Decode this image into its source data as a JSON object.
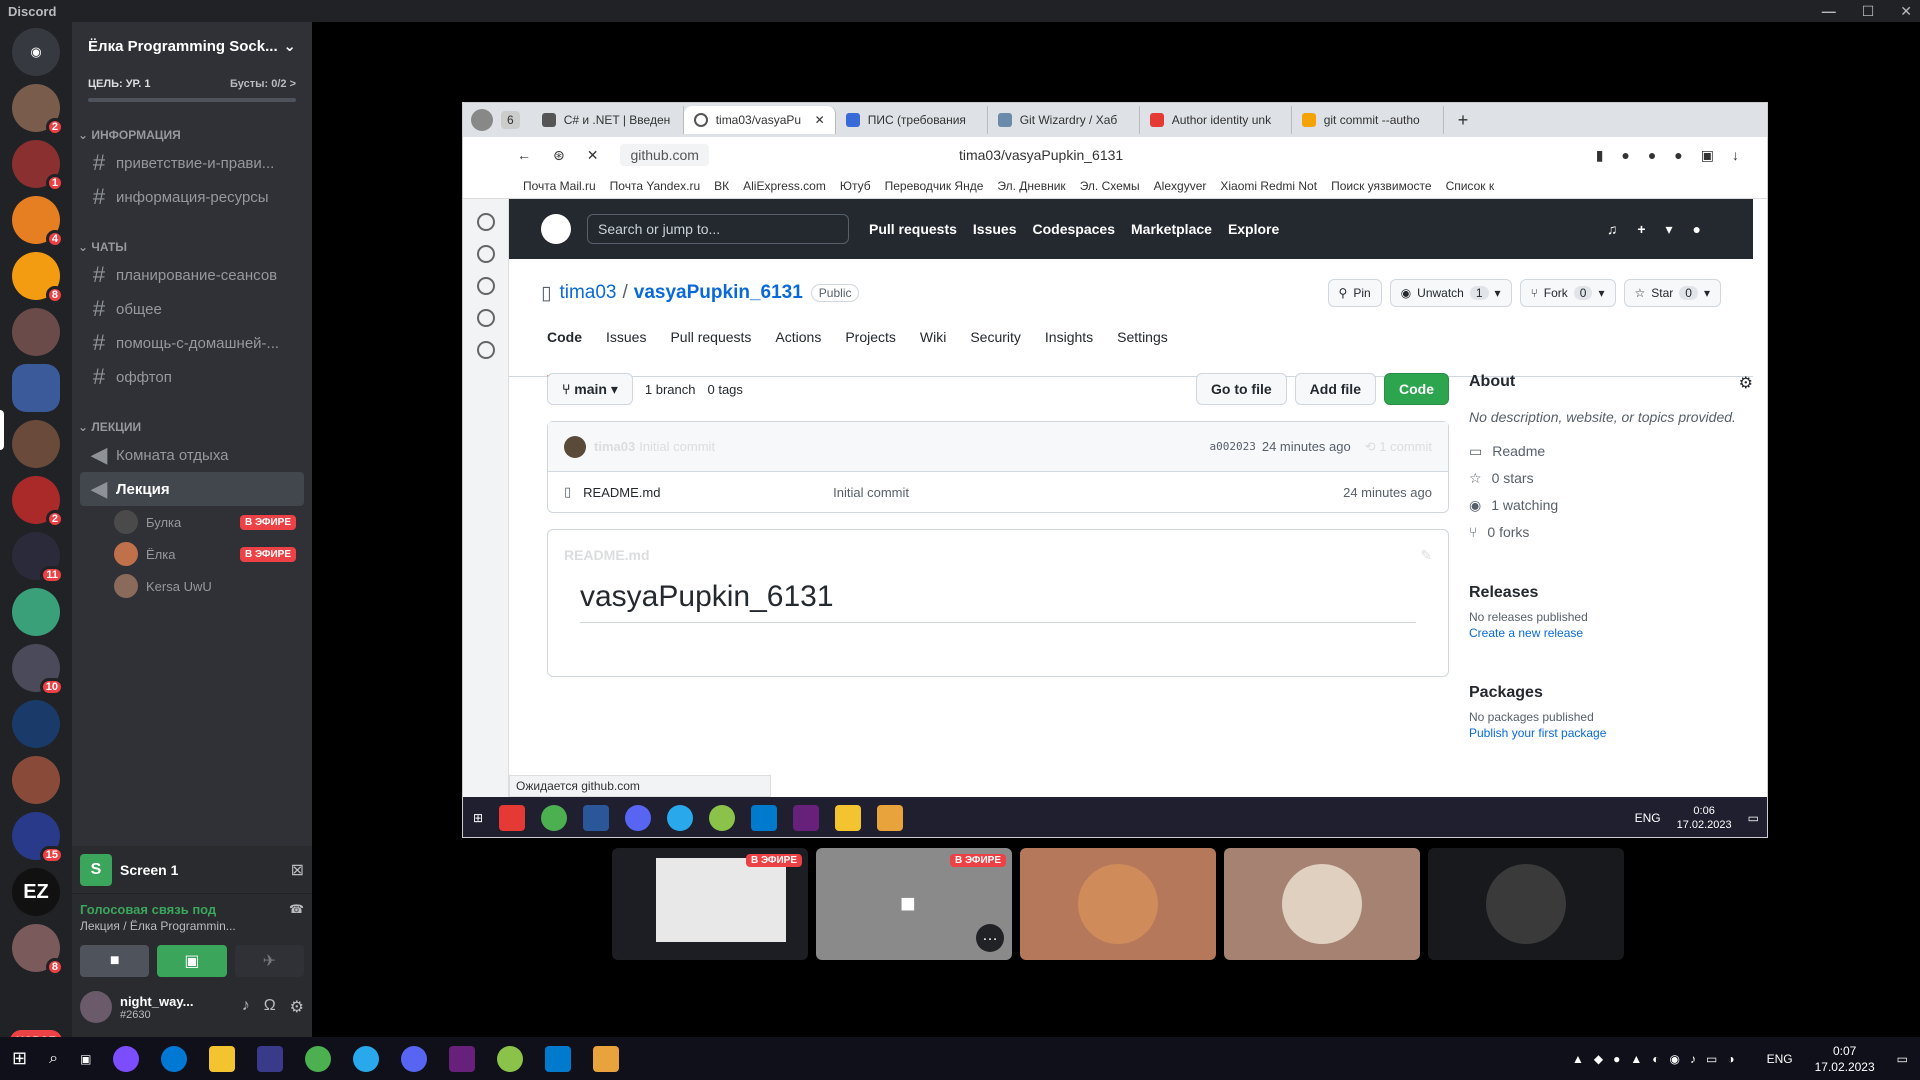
{
  "app": {
    "title": "Discord"
  },
  "server": {
    "name": "Ёлка Programming Sock...",
    "goal": "ЦЕЛЬ: УР. 1",
    "boosts": "Бусты: 0/2 >",
    "categories": [
      {
        "name": "ИНФОРМАЦИЯ",
        "channels": [
          {
            "name": "приветствие-и-прави..."
          },
          {
            "name": "информация-ресурсы"
          }
        ]
      },
      {
        "name": "ЧАТЫ",
        "channels": [
          {
            "name": "планирование-сеансов"
          },
          {
            "name": "общее"
          },
          {
            "name": "помощь-с-домашней-..."
          },
          {
            "name": "оффтоп"
          }
        ]
      },
      {
        "name": "ЛЕКЦИИ"
      }
    ],
    "voice": [
      {
        "name": "Комната отдыха"
      },
      {
        "name": "Лекция"
      }
    ],
    "voice_users": [
      {
        "name": "Булка",
        "live": "В ЭФИРЕ"
      },
      {
        "name": "Ёлка",
        "live": "В ЭФИРЕ"
      },
      {
        "name": "Kersa UwU"
      }
    ]
  },
  "guild_badges": [
    "2",
    "1",
    "4",
    "8",
    "2",
    "11",
    "10",
    "15",
    "8"
  ],
  "guild_labels": {
    "ez": "EZ",
    "new": "НОВОЕ"
  },
  "panel": {
    "screen": "Screen 1",
    "voice_status": "Голосовая связь под",
    "voice_channel": "Лекция / Ёлка Programmin...",
    "username": "night_way...",
    "usertag": "#2630"
  },
  "browser": {
    "tab_count": "6",
    "tabs": [
      {
        "title": "C# и .NET | Введен"
      },
      {
        "title": "tima03/vasyaPu",
        "active": true
      },
      {
        "title": "ПИС (требования"
      },
      {
        "title": "Git Wizardry / Хаб"
      },
      {
        "title": "Author identity unk"
      },
      {
        "title": "git commit --autho"
      }
    ],
    "url": "github.com",
    "page_title": "tima03/vasyaPupkin_6131",
    "bookmarks": [
      "Почта Mail.ru",
      "Почта Yandex.ru",
      "ВК",
      "AliExpress.com",
      "Ютуб",
      "Переводчик Янде",
      "Эл. Дневник",
      "Эл. Схемы",
      "Alexgyver",
      "Xiaomi Redmi Not",
      "Поиск уязвимосте",
      "Список к"
    ],
    "status": "Ожидается github.com"
  },
  "github": {
    "search": "Search or jump to...",
    "nav": [
      "Pull requests",
      "Issues",
      "Codespaces",
      "Marketplace",
      "Explore"
    ],
    "owner": "tima03",
    "repo": "vasyaPupkin_6131",
    "visibility": "Public",
    "actions": {
      "pin": "Pin",
      "unwatch": "Unwatch",
      "watch_count": "1",
      "fork": "Fork",
      "fork_count": "0",
      "star": "Star",
      "star_count": "0"
    },
    "tabs": [
      "Code",
      "Issues",
      "Pull requests",
      "Actions",
      "Projects",
      "Wiki",
      "Security",
      "Insights",
      "Settings"
    ],
    "branch": "main",
    "branches": "1 branch",
    "tags": "0 tags",
    "goto": "Go to file",
    "addfile": "Add file",
    "code": "Code",
    "commit": {
      "author": "tima03",
      "message": "Initial commit",
      "hash": "a002023",
      "time": "24 minutes ago",
      "count": "1 commit"
    },
    "files": [
      {
        "name": "README.md",
        "message": "Initial commit",
        "time": "24 minutes ago"
      }
    ],
    "readme_title": "README.md",
    "readme_h1": "vasyaPupkin_6131",
    "about": {
      "title": "About",
      "desc": "No description, website, or topics provided.",
      "readme": "Readme",
      "stars": "0 stars",
      "watching": "1 watching",
      "forks": "0 forks"
    },
    "releases": {
      "title": "Releases",
      "none": "No releases published",
      "create": "Create a new release"
    },
    "packages": {
      "title": "Packages",
      "none": "No packages published",
      "publish": "Publish your first package"
    }
  },
  "inner_taskbar": {
    "lang": "ENG",
    "time": "0:06",
    "date": "17.02.2023"
  },
  "thumbnails": [
    {
      "live": "В ЭФИРЕ"
    },
    {
      "live": "В ЭФИРЕ"
    }
  ],
  "taskbar": {
    "lang": "ENG",
    "time": "0:07",
    "date": "17.02.2023"
  }
}
